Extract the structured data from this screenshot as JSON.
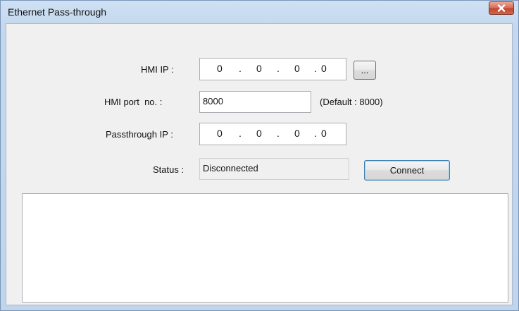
{
  "window": {
    "title": "Ethernet Pass-through"
  },
  "close_icon": "close-icon",
  "hmi_ip": {
    "label": "HMI IP :",
    "octets": [
      "0",
      "0",
      "0",
      "0"
    ],
    "browse_label": "..."
  },
  "hmi_port": {
    "label": "HMI port  no. :",
    "value": "8000",
    "default_note": "(Default : 8000)"
  },
  "passthrough_ip": {
    "label": "Passthrough IP :",
    "octets": [
      "0",
      "0",
      "0",
      "0"
    ]
  },
  "status": {
    "label": "Status :",
    "value": "Disconnected"
  },
  "connect_button": {
    "label": "Connect"
  },
  "log": {
    "content": ""
  }
}
